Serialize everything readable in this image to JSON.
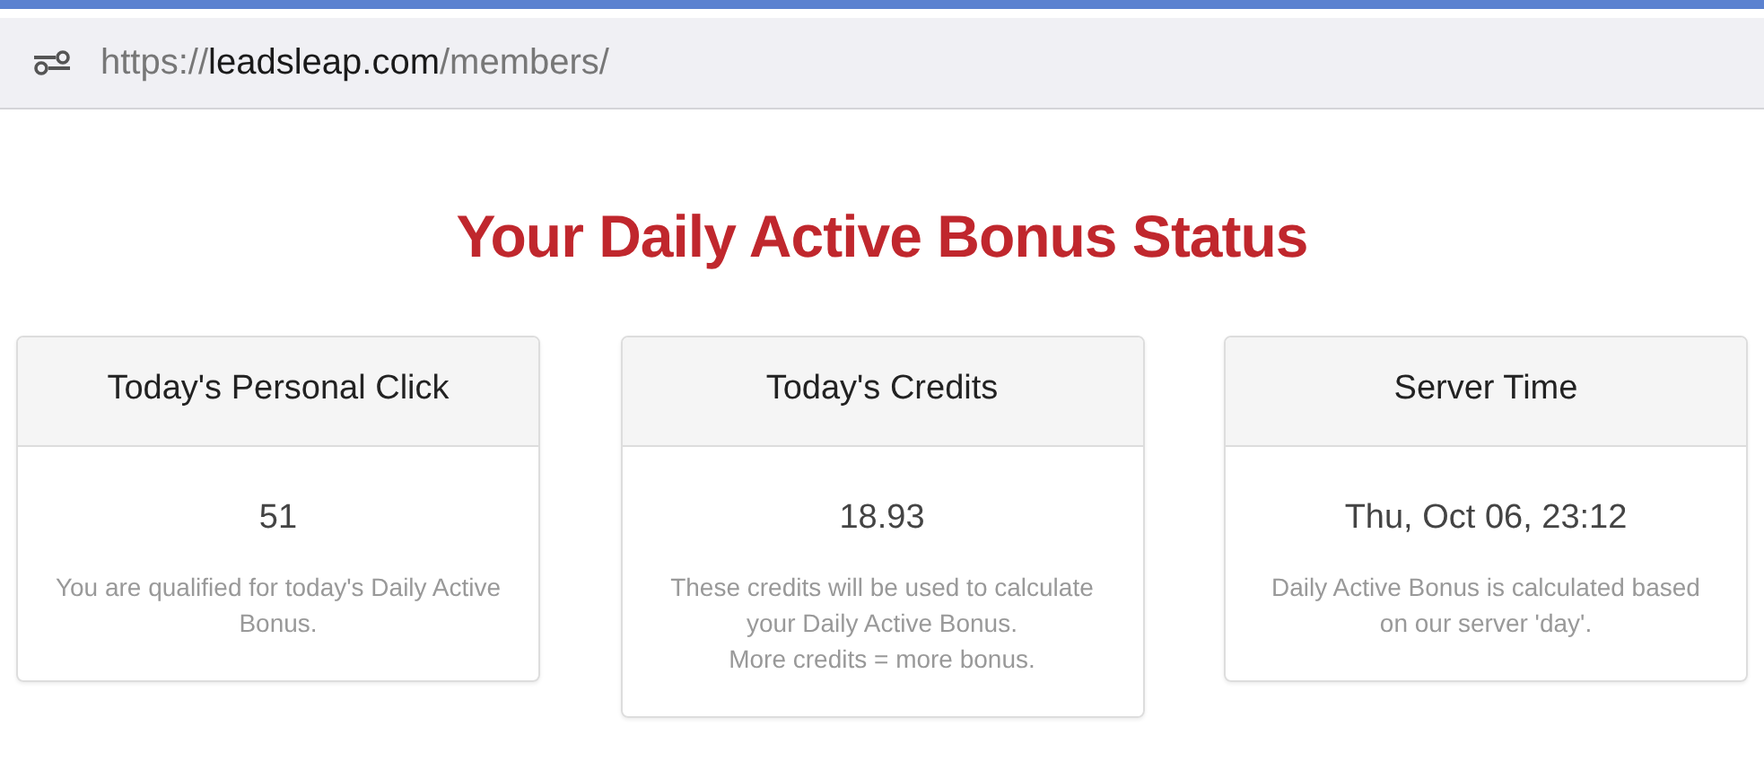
{
  "address_bar": {
    "scheme": "https://",
    "domain": "leadsleap.com",
    "path": "/members/"
  },
  "title": "Your Daily Active Bonus Status",
  "cards": [
    {
      "heading": "Today's Personal Click",
      "value": "51",
      "notes": [
        "You are qualified for today's Daily Active Bonus."
      ]
    },
    {
      "heading": "Today's Credits",
      "value": "18.93",
      "notes": [
        "These credits will be used to calculate your Daily Active Bonus.",
        "More credits = more bonus."
      ]
    },
    {
      "heading": "Server Time",
      "value": "Thu, Oct 06, 23:12",
      "notes": [
        "Daily Active Bonus is calculated based on our server 'day'."
      ]
    }
  ]
}
